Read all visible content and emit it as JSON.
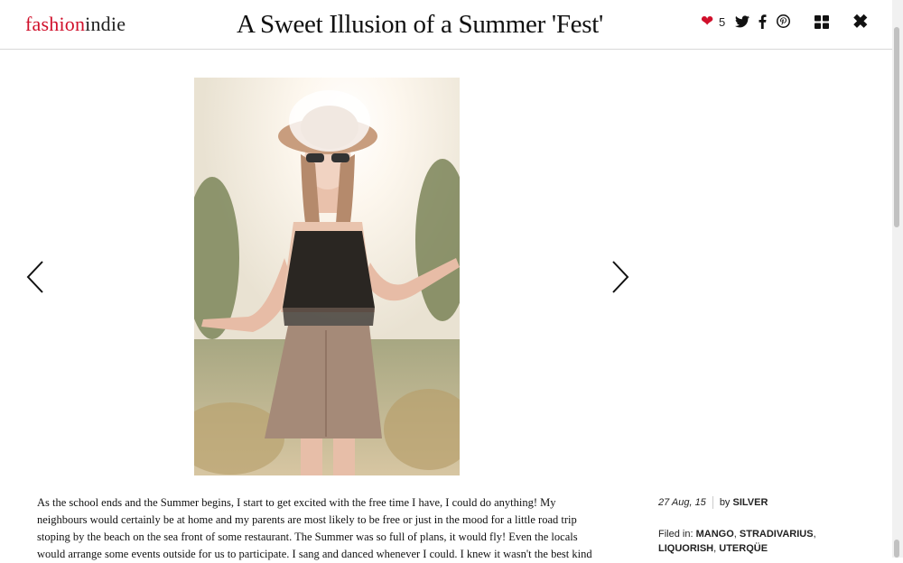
{
  "site": {
    "logo_part1": "fashion",
    "logo_part2": "indie"
  },
  "header": {
    "title": "A Sweet Illusion of a Summer 'Fest'",
    "like_count": "5"
  },
  "icons": [
    "heart-icon",
    "twitter-icon",
    "facebook-icon",
    "pinterest-icon",
    "grid-icon",
    "close-icon",
    "chevron-left-icon",
    "chevron-right-icon"
  ],
  "colors": {
    "brand": "#d0102b",
    "text": "#111111"
  },
  "article": {
    "lines": [
      "As the school ends and the Summer begins, I start to get excited with the free time I have, I could do anything! My",
      "neighbours would certainly be at home and my parents are most likely to be free or just in the mood for a little road trip",
      "stoping by the beach on the sea front of some restaurant. The Summer was so full of plans, it would fly! Even the locals",
      "would arrange some events outside for us to participate. I sang and danced whenever I could. I knew it wasn't the best kind"
    ]
  },
  "meta": {
    "date": "27 Aug, 15",
    "by_label": "by",
    "author": "SILVER",
    "filed_label": "Filed in:",
    "tags": [
      "MANGO",
      "STRADIVARIUS",
      "LIQUORISH",
      "UTERQÜE"
    ]
  }
}
